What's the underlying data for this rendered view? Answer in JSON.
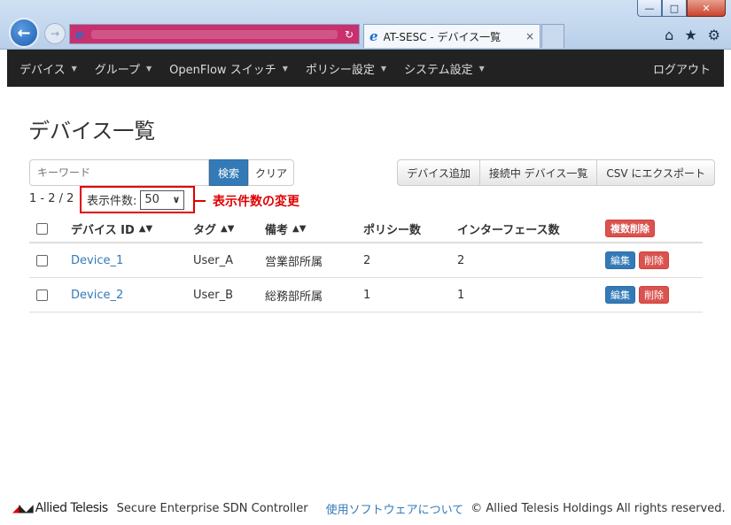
{
  "browser": {
    "tab_title": "AT-SESC - デバイス一覧",
    "tab_close": "×",
    "refresh_glyph": "↻",
    "window_controls": {
      "minimize": "—",
      "maximize": "□",
      "close": "✕"
    }
  },
  "navbar": {
    "items": [
      {
        "label": "デバイス"
      },
      {
        "label": "グループ"
      },
      {
        "label": "OpenFlow スイッチ"
      },
      {
        "label": "ポリシー設定"
      },
      {
        "label": "システム設定"
      }
    ],
    "logout": "ログアウト"
  },
  "page": {
    "title": "デバイス一覧",
    "search_placeholder": "キーワード",
    "search_button": "検索",
    "clear_button": "クリア",
    "actions": {
      "add_device": "デバイス追加",
      "connected_devices": "接続中 デバイス一覧",
      "csv_export": "CSV にエクスポート"
    },
    "count": "1 - 2 / 2",
    "per_page_label": "表示件数:",
    "per_page_value": "50",
    "annotation": "表示件数の変更"
  },
  "table": {
    "headers": {
      "device_id": "デバイス ID",
      "tag": "タグ",
      "note": "備考",
      "policy_count": "ポリシー数",
      "interface_count": "インターフェース数",
      "bulk_delete": "複数削除"
    },
    "rows": [
      {
        "device_id": "Device_1",
        "tag": "User_A",
        "note": "営業部所属",
        "policy_count": "2",
        "interface_count": "2",
        "edit": "編集",
        "delete": "削除"
      },
      {
        "device_id": "Device_2",
        "tag": "User_B",
        "note": "総務部所属",
        "policy_count": "1",
        "interface_count": "1",
        "edit": "編集",
        "delete": "削除"
      }
    ]
  },
  "footer": {
    "brand": "Allied Telesis",
    "product": "Secure Enterprise SDN Controller",
    "software_link": "使用ソフトウェアについて",
    "copyright": "© Allied Telesis Holdings All rights reserved."
  },
  "colors": {
    "navbar_bg": "#222222",
    "primary": "#337ab7",
    "danger": "#d9534f",
    "annotation": "#e00000"
  }
}
